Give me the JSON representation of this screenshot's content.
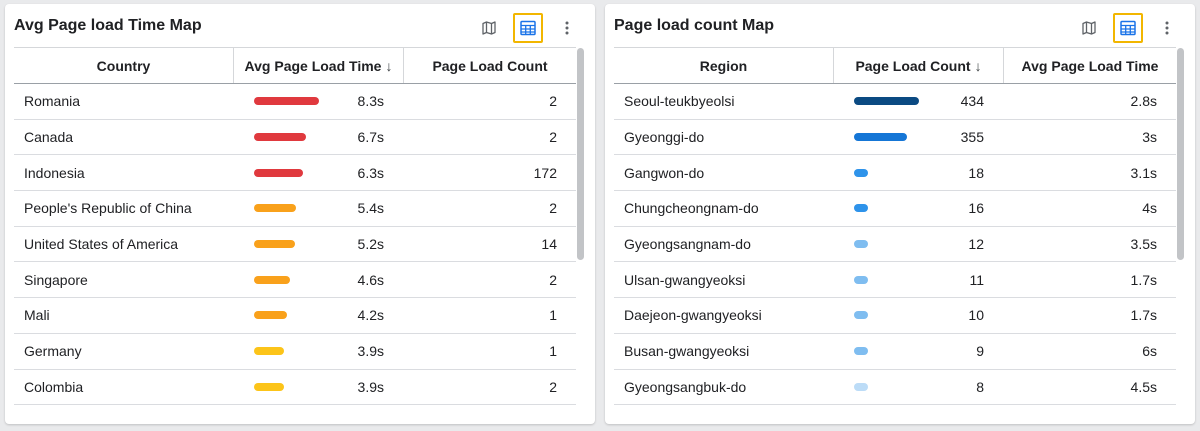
{
  "panels": [
    {
      "title": "Avg Page load Time Map",
      "columns": [
        "Country",
        "Avg Page Load Time",
        "Page Load Count"
      ],
      "sort_icon": "↓",
      "rows": [
        {
          "name": "Romania",
          "bar_fraction": 0.83,
          "bar_color": "#e0393e",
          "value": "8.3s",
          "count": "2"
        },
        {
          "name": "Canada",
          "bar_fraction": 0.67,
          "bar_color": "#e0393e",
          "value": "6.7s",
          "count": "2"
        },
        {
          "name": "Indonesia",
          "bar_fraction": 0.63,
          "bar_color": "#e0393e",
          "value": "6.3s",
          "count": "172"
        },
        {
          "name": "People's Republic of China",
          "bar_fraction": 0.54,
          "bar_color": "#f9a11b",
          "value": "5.4s",
          "count": "2"
        },
        {
          "name": "United States of America",
          "bar_fraction": 0.52,
          "bar_color": "#f9a11b",
          "value": "5.2s",
          "count": "14"
        },
        {
          "name": "Singapore",
          "bar_fraction": 0.46,
          "bar_color": "#f9a11b",
          "value": "4.6s",
          "count": "2"
        },
        {
          "name": "Mali",
          "bar_fraction": 0.42,
          "bar_color": "#f9a11b",
          "value": "4.2s",
          "count": "1"
        },
        {
          "name": "Germany",
          "bar_fraction": 0.39,
          "bar_color": "#fcc419",
          "value": "3.9s",
          "count": "1"
        },
        {
          "name": "Colombia",
          "bar_fraction": 0.39,
          "bar_color": "#fcc419",
          "value": "3.9s",
          "count": "2"
        }
      ]
    },
    {
      "title": "Page load count Map",
      "columns": [
        "Region",
        "Page Load Count",
        "Avg Page Load Time"
      ],
      "sort_icon": "↓",
      "rows": [
        {
          "name": "Seoul-teukbyeolsi",
          "bar_fraction": 0.434,
          "bar_color": "#0b4a82",
          "value": "434",
          "count": "2.8s"
        },
        {
          "name": "Gyeonggi-do",
          "bar_fraction": 0.355,
          "bar_color": "#1576d6",
          "value": "355",
          "count": "3s"
        },
        {
          "name": "Gangwon-do",
          "bar_fraction": 0.018,
          "bar_color": "#2e93ea",
          "value": "18",
          "count": "3.1s"
        },
        {
          "name": "Chungcheongnam-do",
          "bar_fraction": 0.016,
          "bar_color": "#2e93ea",
          "value": "16",
          "count": "4s"
        },
        {
          "name": "Gyeongsangnam-do",
          "bar_fraction": 0.012,
          "bar_color": "#7fbdf0",
          "value": "12",
          "count": "3.5s"
        },
        {
          "name": "Ulsan-gwangyeoksi",
          "bar_fraction": 0.011,
          "bar_color": "#7fbdf0",
          "value": "11",
          "count": "1.7s"
        },
        {
          "name": "Daejeon-gwangyeoksi",
          "bar_fraction": 0.01,
          "bar_color": "#7fbdf0",
          "value": "10",
          "count": "1.7s"
        },
        {
          "name": "Busan-gwangyeoksi",
          "bar_fraction": 0.009,
          "bar_color": "#7fbdf0",
          "value": "9",
          "count": "6s"
        },
        {
          "name": "Gyeongsangbuk-do",
          "bar_fraction": 0.008,
          "bar_color": "#bcdcf7",
          "value": "8",
          "count": "4.5s"
        }
      ]
    }
  ],
  "icons": {
    "map": "map-icon",
    "table": "table-icon",
    "more": "more-vert-icon"
  },
  "colors": {
    "selected_outline": "#f2b600",
    "table_icon": "#1a73e8"
  }
}
